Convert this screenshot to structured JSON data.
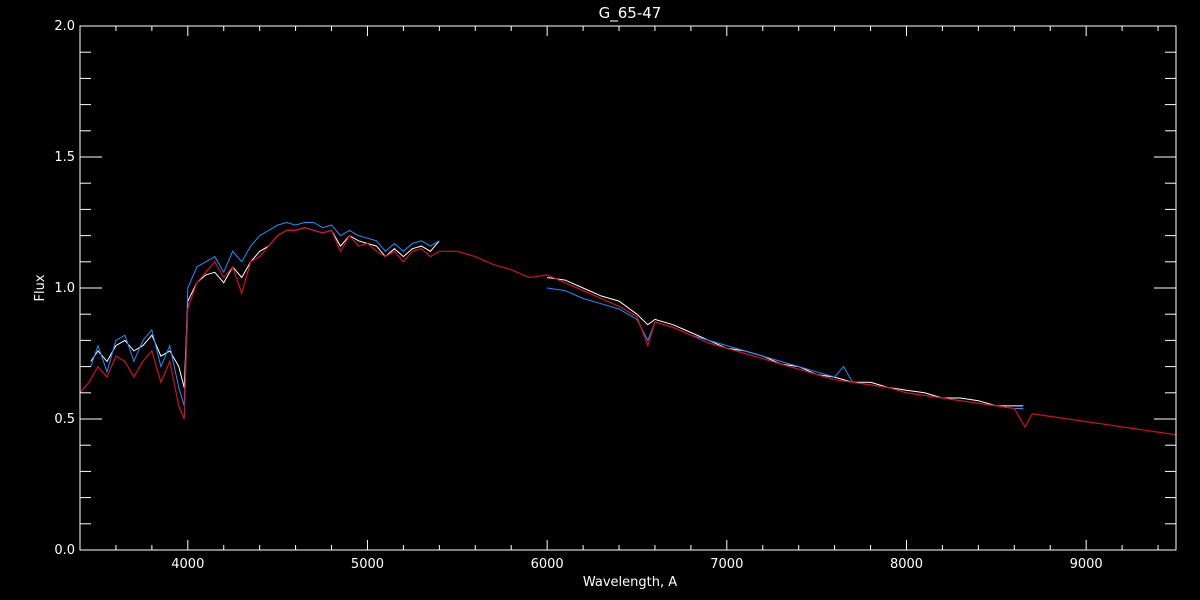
{
  "chart_data": {
    "type": "line",
    "title": "G_65-47",
    "xlabel": "Wavelength, A",
    "ylabel": "Flux",
    "xlim": [
      3400,
      9500
    ],
    "ylim": [
      0.0,
      2.0
    ],
    "x_ticks": [
      4000,
      5000,
      6000,
      7000,
      8000,
      9000
    ],
    "x_tick_labels": [
      "4000",
      "5000",
      "6000",
      "7000",
      "8000",
      "9000"
    ],
    "y_ticks": [
      0.0,
      0.5,
      1.0,
      1.5,
      2.0
    ],
    "y_tick_labels": [
      "0.0",
      "0.5",
      "1.0",
      "1.5",
      "2.0"
    ],
    "grid": false,
    "colors": {
      "background": "#000000",
      "axes": "#ffffff",
      "observed_white": "#ffffff",
      "observed_blue": "#1e90ff",
      "model_red": "#d01020"
    },
    "series": [
      {
        "color": "#ffffff",
        "segments": [
          {
            "x": [
              3460,
              3500,
              3550,
              3600,
              3650,
              3700,
              3750,
              3800,
              3850,
              3900,
              3950,
              3980,
              4000,
              4050,
              4100,
              4150,
              4200,
              4250,
              4300,
              4350,
              4400,
              4450,
              4500,
              4550,
              4600,
              4650,
              4700,
              4750,
              4800,
              4850,
              4900,
              4950,
              5000,
              5050,
              5100,
              5150,
              5200,
              5250,
              5300,
              5350,
              5400
            ],
            "y": [
              0.72,
              0.76,
              0.72,
              0.78,
              0.8,
              0.76,
              0.78,
              0.82,
              0.74,
              0.76,
              0.7,
              0.62,
              0.95,
              1.02,
              1.05,
              1.06,
              1.02,
              1.08,
              1.04,
              1.1,
              1.14,
              1.16,
              1.2,
              1.22,
              1.22,
              1.23,
              1.22,
              1.21,
              1.22,
              1.16,
              1.2,
              1.18,
              1.17,
              1.16,
              1.12,
              1.15,
              1.12,
              1.15,
              1.16,
              1.14,
              1.18
            ]
          },
          {
            "x": [
              6000,
              6100,
              6200,
              6300,
              6400,
              6500,
              6560,
              6600,
              6700,
              6800,
              6900,
              7000,
              7100,
              7200,
              7300,
              7400,
              7500,
              7600,
              7700,
              7800,
              7900,
              8000,
              8100,
              8200,
              8300,
              8400,
              8500,
              8600,
              8650
            ],
            "y": [
              1.04,
              1.03,
              1.0,
              0.97,
              0.95,
              0.9,
              0.86,
              0.88,
              0.86,
              0.83,
              0.8,
              0.77,
              0.76,
              0.74,
              0.71,
              0.7,
              0.67,
              0.66,
              0.64,
              0.64,
              0.62,
              0.61,
              0.6,
              0.58,
              0.58,
              0.57,
              0.55,
              0.55,
              0.55
            ]
          }
        ]
      },
      {
        "color": "#1e90ff",
        "segments": [
          {
            "x": [
              3460,
              3500,
              3550,
              3600,
              3650,
              3700,
              3750,
              3800,
              3850,
              3900,
              3950,
              3980,
              4000,
              4050,
              4100,
              4150,
              4200,
              4250,
              4300,
              4350,
              4400,
              4450,
              4500,
              4550,
              4600,
              4650,
              4700,
              4750,
              4800,
              4850,
              4900,
              4950,
              5000,
              5050,
              5100,
              5150,
              5200,
              5250,
              5300,
              5350,
              5400
            ],
            "y": [
              0.7,
              0.78,
              0.68,
              0.8,
              0.82,
              0.72,
              0.8,
              0.84,
              0.7,
              0.78,
              0.62,
              0.55,
              1.0,
              1.08,
              1.1,
              1.12,
              1.06,
              1.14,
              1.1,
              1.16,
              1.2,
              1.22,
              1.24,
              1.25,
              1.24,
              1.25,
              1.25,
              1.23,
              1.24,
              1.2,
              1.22,
              1.2,
              1.19,
              1.18,
              1.14,
              1.17,
              1.14,
              1.17,
              1.18,
              1.16,
              1.18
            ]
          },
          {
            "x": [
              6000,
              6100,
              6200,
              6300,
              6400,
              6500,
              6560,
              6600,
              6700,
              6800,
              6900,
              7000,
              7100,
              7200,
              7300,
              7400,
              7500,
              7600,
              7650,
              7700,
              7800,
              7900,
              8000,
              8100,
              8200,
              8300,
              8400,
              8500,
              8600,
              8650
            ],
            "y": [
              1.0,
              0.99,
              0.96,
              0.94,
              0.92,
              0.88,
              0.8,
              0.87,
              0.85,
              0.82,
              0.8,
              0.78,
              0.76,
              0.74,
              0.72,
              0.7,
              0.68,
              0.66,
              0.7,
              0.64,
              0.63,
              0.62,
              0.6,
              0.59,
              0.58,
              0.57,
              0.56,
              0.55,
              0.54,
              0.54
            ]
          }
        ]
      },
      {
        "color": "#d01020",
        "segments": [
          {
            "x": [
              3400,
              3450,
              3500,
              3550,
              3600,
              3650,
              3700,
              3750,
              3800,
              3850,
              3900,
              3950,
              3980,
              4000,
              4050,
              4100,
              4150,
              4200,
              4250,
              4300,
              4350,
              4400,
              4450,
              4500,
              4550,
              4600,
              4650,
              4700,
              4750,
              4800,
              4850,
              4900,
              4950,
              5000,
              5050,
              5100,
              5150,
              5200,
              5250,
              5300,
              5350,
              5400,
              5500,
              5600,
              5700,
              5800,
              5900,
              6000,
              6100,
              6200,
              6300,
              6400,
              6500,
              6560,
              6600,
              6700,
              6800,
              6900,
              7000,
              7100,
              7200,
              7300,
              7400,
              7500,
              7600,
              7700,
              7800,
              7900,
              8000,
              8100,
              8200,
              8300,
              8400,
              8500,
              8600,
              8660,
              8700,
              8800,
              8900,
              9000,
              9100,
              9200,
              9300,
              9400,
              9500
            ],
            "y": [
              0.6,
              0.64,
              0.7,
              0.66,
              0.74,
              0.72,
              0.66,
              0.72,
              0.76,
              0.64,
              0.72,
              0.55,
              0.5,
              0.92,
              1.02,
              1.06,
              1.1,
              1.04,
              1.08,
              0.98,
              1.1,
              1.12,
              1.16,
              1.2,
              1.22,
              1.22,
              1.23,
              1.22,
              1.21,
              1.22,
              1.14,
              1.2,
              1.16,
              1.17,
              1.14,
              1.12,
              1.14,
              1.1,
              1.14,
              1.15,
              1.12,
              1.14,
              1.14,
              1.12,
              1.09,
              1.07,
              1.04,
              1.05,
              1.02,
              0.99,
              0.96,
              0.93,
              0.89,
              0.78,
              0.87,
              0.85,
              0.82,
              0.79,
              0.77,
              0.75,
              0.73,
              0.71,
              0.69,
              0.67,
              0.65,
              0.64,
              0.63,
              0.62,
              0.6,
              0.59,
              0.58,
              0.57,
              0.56,
              0.55,
              0.54,
              0.47,
              0.52,
              0.51,
              0.5,
              0.49,
              0.48,
              0.47,
              0.46,
              0.45,
              0.44
            ]
          }
        ]
      },
      {
        "color": "#1e90ff",
        "segments": [
          {
            "x": [
              3460,
              5400
            ],
            "y": [
              0.0,
              0.0
            ]
          },
          {
            "x": [
              6000,
              8650
            ],
            "y": [
              0.0,
              0.0
            ]
          }
        ]
      }
    ]
  }
}
